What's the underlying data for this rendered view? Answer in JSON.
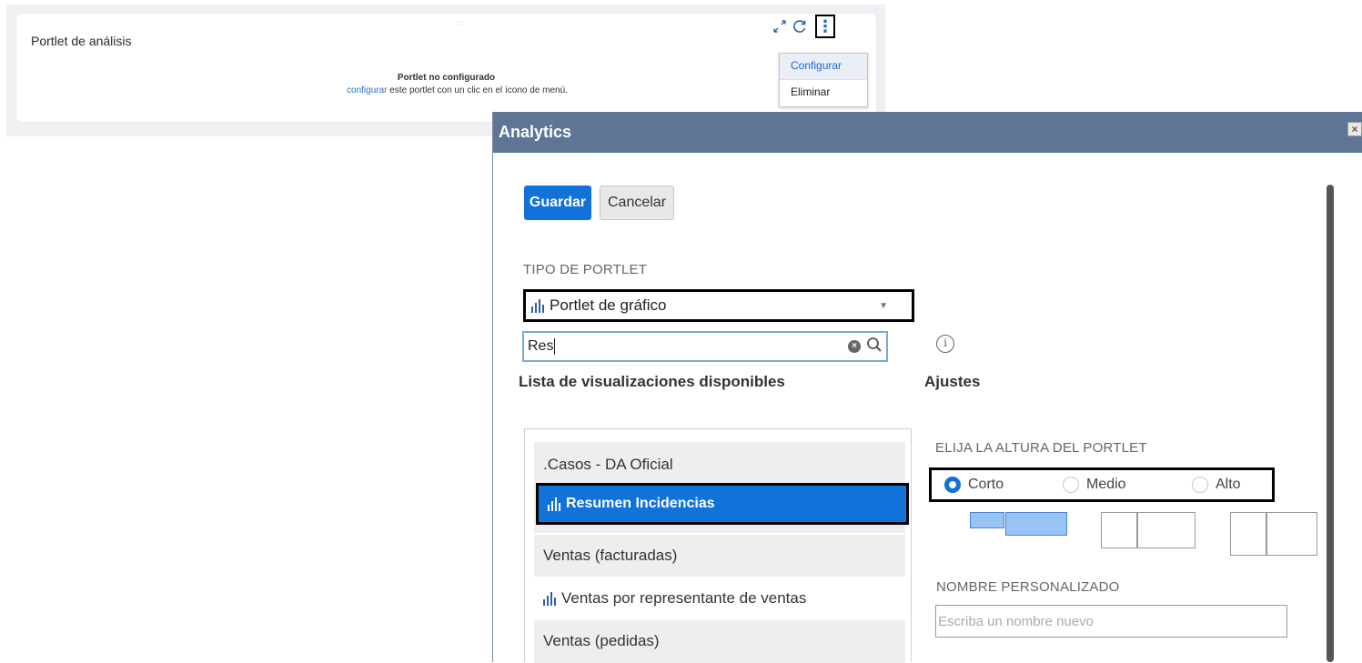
{
  "portlet": {
    "title": "Portlet de análisis",
    "drag_glyph": ":::",
    "not_configured": "Portlet no configurado",
    "configure_link": "configurar",
    "configure_rest": " este portlet con un clic en el ícono de menú.",
    "icons": [
      "expand-icon",
      "refresh-icon",
      "more-vertical-icon"
    ]
  },
  "portlet_menu": {
    "items": [
      "Configurar",
      "Eliminar"
    ],
    "active_index": 0
  },
  "dialog": {
    "title": "Analytics",
    "close_glyph": "×",
    "buttons": {
      "save": "Guardar",
      "cancel": "Cancelar"
    },
    "portlet_type": {
      "label": "TIPO DE PORTLET",
      "selected": "Portlet de gráfico"
    },
    "search": {
      "value": "Res"
    },
    "list": {
      "title": "Lista de visualizaciones disponibles",
      "groups": [
        {
          "header": ".Casos - DA Oficial",
          "items": [
            "Resumen Incidencias"
          ]
        },
        {
          "header": "Ventas (facturadas)",
          "items": [
            "Ventas por representante de ventas"
          ]
        },
        {
          "header": "Ventas (pedidas)",
          "items": []
        }
      ],
      "selected_item": "Resumen Incidencias"
    },
    "settings": {
      "title": "Ajustes",
      "height_label": "ELIJA LA ALTURA DEL PORTLET",
      "height_options": [
        "Corto",
        "Medio",
        "Alto"
      ],
      "height_selected": "Corto",
      "custom_name_label": "NOMBRE PERSONALIZADO",
      "custom_name_placeholder": "Escriba un nombre nuevo",
      "custom_name_value": ""
    }
  },
  "colors": {
    "header_bg": "#5f7596",
    "primary": "#1172d9",
    "link": "#2e6bbf",
    "highlight_border": "#000000"
  }
}
